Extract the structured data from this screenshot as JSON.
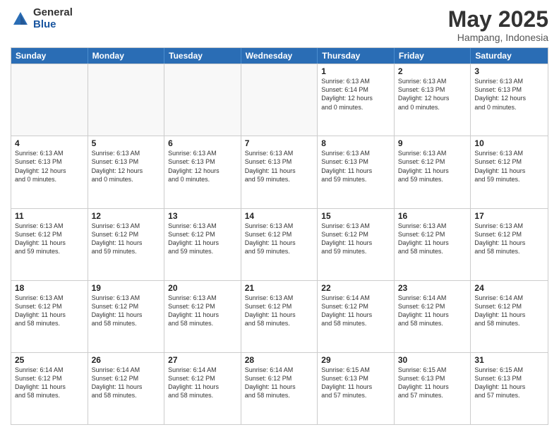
{
  "header": {
    "logo_general": "General",
    "logo_blue": "Blue",
    "month_title": "May 2025",
    "location": "Hampang, Indonesia"
  },
  "days_of_week": [
    "Sunday",
    "Monday",
    "Tuesday",
    "Wednesday",
    "Thursday",
    "Friday",
    "Saturday"
  ],
  "weeks": [
    [
      {
        "day": "",
        "text": ""
      },
      {
        "day": "",
        "text": ""
      },
      {
        "day": "",
        "text": ""
      },
      {
        "day": "",
        "text": ""
      },
      {
        "day": "1",
        "text": "Sunrise: 6:13 AM\nSunset: 6:14 PM\nDaylight: 12 hours\nand 0 minutes."
      },
      {
        "day": "2",
        "text": "Sunrise: 6:13 AM\nSunset: 6:13 PM\nDaylight: 12 hours\nand 0 minutes."
      },
      {
        "day": "3",
        "text": "Sunrise: 6:13 AM\nSunset: 6:13 PM\nDaylight: 12 hours\nand 0 minutes."
      }
    ],
    [
      {
        "day": "4",
        "text": "Sunrise: 6:13 AM\nSunset: 6:13 PM\nDaylight: 12 hours\nand 0 minutes."
      },
      {
        "day": "5",
        "text": "Sunrise: 6:13 AM\nSunset: 6:13 PM\nDaylight: 12 hours\nand 0 minutes."
      },
      {
        "day": "6",
        "text": "Sunrise: 6:13 AM\nSunset: 6:13 PM\nDaylight: 12 hours\nand 0 minutes."
      },
      {
        "day": "7",
        "text": "Sunrise: 6:13 AM\nSunset: 6:13 PM\nDaylight: 11 hours\nand 59 minutes."
      },
      {
        "day": "8",
        "text": "Sunrise: 6:13 AM\nSunset: 6:13 PM\nDaylight: 11 hours\nand 59 minutes."
      },
      {
        "day": "9",
        "text": "Sunrise: 6:13 AM\nSunset: 6:12 PM\nDaylight: 11 hours\nand 59 minutes."
      },
      {
        "day": "10",
        "text": "Sunrise: 6:13 AM\nSunset: 6:12 PM\nDaylight: 11 hours\nand 59 minutes."
      }
    ],
    [
      {
        "day": "11",
        "text": "Sunrise: 6:13 AM\nSunset: 6:12 PM\nDaylight: 11 hours\nand 59 minutes."
      },
      {
        "day": "12",
        "text": "Sunrise: 6:13 AM\nSunset: 6:12 PM\nDaylight: 11 hours\nand 59 minutes."
      },
      {
        "day": "13",
        "text": "Sunrise: 6:13 AM\nSunset: 6:12 PM\nDaylight: 11 hours\nand 59 minutes."
      },
      {
        "day": "14",
        "text": "Sunrise: 6:13 AM\nSunset: 6:12 PM\nDaylight: 11 hours\nand 59 minutes."
      },
      {
        "day": "15",
        "text": "Sunrise: 6:13 AM\nSunset: 6:12 PM\nDaylight: 11 hours\nand 59 minutes."
      },
      {
        "day": "16",
        "text": "Sunrise: 6:13 AM\nSunset: 6:12 PM\nDaylight: 11 hours\nand 58 minutes."
      },
      {
        "day": "17",
        "text": "Sunrise: 6:13 AM\nSunset: 6:12 PM\nDaylight: 11 hours\nand 58 minutes."
      }
    ],
    [
      {
        "day": "18",
        "text": "Sunrise: 6:13 AM\nSunset: 6:12 PM\nDaylight: 11 hours\nand 58 minutes."
      },
      {
        "day": "19",
        "text": "Sunrise: 6:13 AM\nSunset: 6:12 PM\nDaylight: 11 hours\nand 58 minutes."
      },
      {
        "day": "20",
        "text": "Sunrise: 6:13 AM\nSunset: 6:12 PM\nDaylight: 11 hours\nand 58 minutes."
      },
      {
        "day": "21",
        "text": "Sunrise: 6:13 AM\nSunset: 6:12 PM\nDaylight: 11 hours\nand 58 minutes."
      },
      {
        "day": "22",
        "text": "Sunrise: 6:14 AM\nSunset: 6:12 PM\nDaylight: 11 hours\nand 58 minutes."
      },
      {
        "day": "23",
        "text": "Sunrise: 6:14 AM\nSunset: 6:12 PM\nDaylight: 11 hours\nand 58 minutes."
      },
      {
        "day": "24",
        "text": "Sunrise: 6:14 AM\nSunset: 6:12 PM\nDaylight: 11 hours\nand 58 minutes."
      }
    ],
    [
      {
        "day": "25",
        "text": "Sunrise: 6:14 AM\nSunset: 6:12 PM\nDaylight: 11 hours\nand 58 minutes."
      },
      {
        "day": "26",
        "text": "Sunrise: 6:14 AM\nSunset: 6:12 PM\nDaylight: 11 hours\nand 58 minutes."
      },
      {
        "day": "27",
        "text": "Sunrise: 6:14 AM\nSunset: 6:12 PM\nDaylight: 11 hours\nand 58 minutes."
      },
      {
        "day": "28",
        "text": "Sunrise: 6:14 AM\nSunset: 6:12 PM\nDaylight: 11 hours\nand 58 minutes."
      },
      {
        "day": "29",
        "text": "Sunrise: 6:15 AM\nSunset: 6:13 PM\nDaylight: 11 hours\nand 57 minutes."
      },
      {
        "day": "30",
        "text": "Sunrise: 6:15 AM\nSunset: 6:13 PM\nDaylight: 11 hours\nand 57 minutes."
      },
      {
        "day": "31",
        "text": "Sunrise: 6:15 AM\nSunset: 6:13 PM\nDaylight: 11 hours\nand 57 minutes."
      }
    ]
  ]
}
